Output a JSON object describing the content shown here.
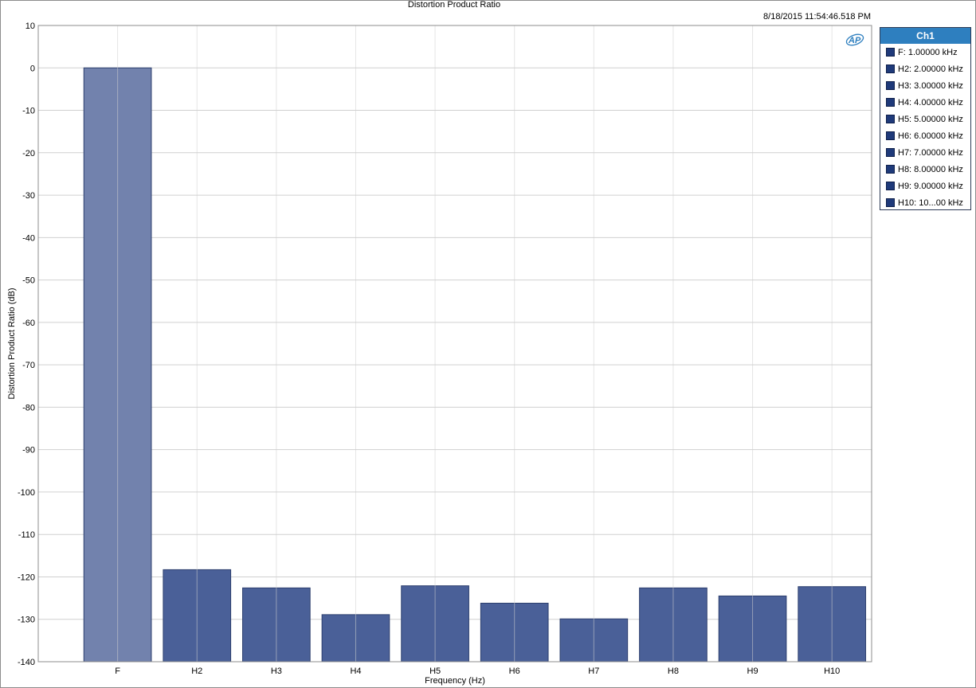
{
  "title": "Distortion Product Ratio",
  "timestamp": "8/18/2015 11:54:46.518 PM",
  "logo_text": "AP",
  "colors": {
    "fundamental_bar": "#7282ad",
    "harmonic_bar": "#4a6098",
    "bar_edge": "#2d3f6e",
    "grid": "#d0d0d0",
    "legend_header": "#2e7fbf",
    "legend_swatch": "#1f3a7a"
  },
  "legend": {
    "header": "Ch1",
    "items": [
      "F: 1.00000 kHz",
      "H2: 2.00000 kHz",
      "H3: 3.00000 kHz",
      "H4: 4.00000 kHz",
      "H5: 5.00000 kHz",
      "H6: 6.00000 kHz",
      "H7: 7.00000 kHz",
      "H8: 8.00000 kHz",
      "H9: 9.00000 kHz",
      "H10: 10...00 kHz"
    ]
  },
  "chart_data": {
    "type": "bar",
    "title": "Distortion Product Ratio",
    "xlabel": "Frequency (Hz)",
    "ylabel": "Distortion Product Ratio (dB)",
    "ylim": [
      -140,
      10
    ],
    "yticks": [
      10,
      0,
      -10,
      -20,
      -30,
      -40,
      -50,
      -60,
      -70,
      -80,
      -90,
      -100,
      -110,
      -120,
      -130,
      -140
    ],
    "categories": [
      "F",
      "H2",
      "H3",
      "H4",
      "H5",
      "H6",
      "H7",
      "H8",
      "H9",
      "H10"
    ],
    "values": [
      0,
      -118.3,
      -122.6,
      -128.9,
      -122.1,
      -126.2,
      -129.9,
      -122.6,
      -124.5,
      -122.3
    ],
    "grid": true,
    "legend_position": "right"
  }
}
